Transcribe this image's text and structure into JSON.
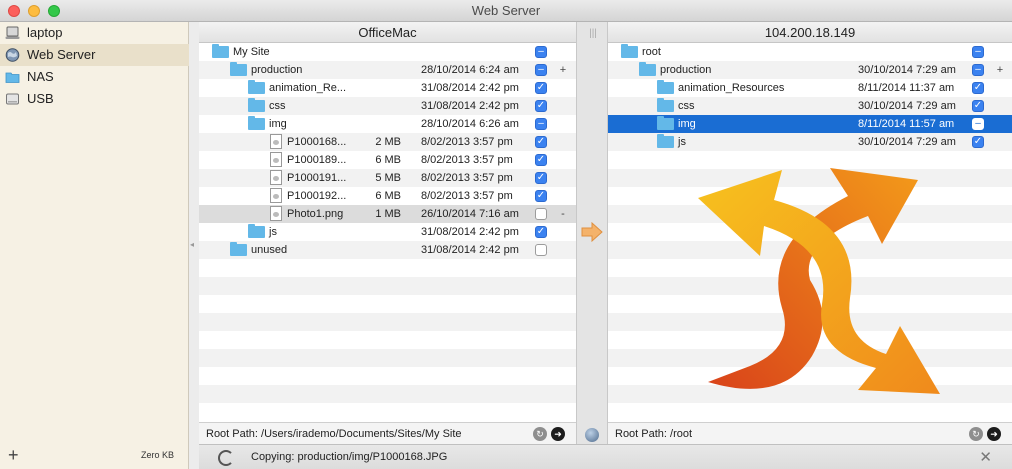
{
  "window": {
    "title": "Web Server"
  },
  "sidebar": {
    "items": [
      {
        "label": "laptop",
        "icon": "laptop-icon"
      },
      {
        "label": "Web Server",
        "icon": "globe-icon"
      },
      {
        "label": "NAS",
        "icon": "folder-icon"
      },
      {
        "label": "USB",
        "icon": "drive-icon"
      }
    ],
    "selected": "Web Server",
    "add_label": "+",
    "footer_size": "Zero KB"
  },
  "left": {
    "header": "OfficeMac",
    "root_path": "Root Path: /Users/irademo/Documents/Sites/My Site",
    "rows": [
      {
        "name": "My Site",
        "size": "",
        "date": "",
        "check": "minus",
        "mark": "",
        "kind": "folder",
        "level": 0,
        "arrow": ""
      },
      {
        "name": "production",
        "size": "",
        "date": "28/10/2014 6:24 am",
        "check": "minus",
        "mark": "+",
        "kind": "folder",
        "level": 1,
        "arrow": "down"
      },
      {
        "name": "animation_Re...",
        "size": "",
        "date": "31/08/2014 2:42 pm",
        "check": "checked",
        "mark": "",
        "kind": "folder",
        "level": 2,
        "arrow": "right"
      },
      {
        "name": "css",
        "size": "",
        "date": "31/08/2014 2:42 pm",
        "check": "checked",
        "mark": "",
        "kind": "folder",
        "level": 2,
        "arrow": "right"
      },
      {
        "name": "img",
        "size": "",
        "date": "28/10/2014 6:26 am",
        "check": "minus",
        "mark": "",
        "kind": "folder",
        "level": 2,
        "arrow": "down"
      },
      {
        "name": "P1000168...",
        "size": "2 MB",
        "date": "8/02/2013 3:57 pm",
        "check": "checked",
        "mark": "",
        "kind": "file",
        "level": 3,
        "arrow": ""
      },
      {
        "name": "P1000189...",
        "size": "6 MB",
        "date": "8/02/2013 3:57 pm",
        "check": "checked",
        "mark": "",
        "kind": "file",
        "level": 3,
        "arrow": ""
      },
      {
        "name": "P1000191...",
        "size": "5 MB",
        "date": "8/02/2013 3:57 pm",
        "check": "checked",
        "mark": "",
        "kind": "file",
        "level": 3,
        "arrow": ""
      },
      {
        "name": "P1000192...",
        "size": "6 MB",
        "date": "8/02/2013 3:57 pm",
        "check": "checked",
        "mark": "",
        "kind": "file",
        "level": 3,
        "arrow": ""
      },
      {
        "name": "Photo1.png",
        "size": "1 MB",
        "date": "26/10/2014 7:16 am",
        "check": "empty",
        "mark": "-",
        "kind": "file",
        "level": 3,
        "arrow": "",
        "highlight": true
      },
      {
        "name": "js",
        "size": "",
        "date": "31/08/2014 2:42 pm",
        "check": "checked",
        "mark": "",
        "kind": "folder",
        "level": 2,
        "arrow": "right"
      },
      {
        "name": "unused",
        "size": "",
        "date": "31/08/2014 2:42 pm",
        "check": "empty",
        "mark": "",
        "kind": "folder",
        "level": 1,
        "arrow": "right"
      }
    ]
  },
  "right": {
    "header": "104.200.18.149",
    "root_path": "Root Path: /root",
    "rows": [
      {
        "name": "root",
        "date": "",
        "check": "minus",
        "mark": "",
        "kind": "folder",
        "level": 0,
        "arrow": ""
      },
      {
        "name": "production",
        "date": "30/10/2014 7:29 am",
        "check": "minus",
        "mark": "+",
        "kind": "folder",
        "level": 1,
        "arrow": "down"
      },
      {
        "name": "animation_Resources",
        "date": "8/11/2014 11:37 am",
        "check": "checked",
        "mark": "",
        "kind": "folder",
        "level": 2,
        "arrow": "right"
      },
      {
        "name": "css",
        "date": "30/10/2014 7:29 am",
        "check": "checked",
        "mark": "",
        "kind": "folder",
        "level": 2,
        "arrow": "right"
      },
      {
        "name": "img",
        "date": "8/11/2014 11:57 am",
        "check": "minus",
        "mark": "",
        "kind": "folder",
        "level": 2,
        "arrow": "right",
        "selected": true
      },
      {
        "name": "js",
        "date": "30/10/2014 7:29 am",
        "check": "checked",
        "mark": "",
        "kind": "folder",
        "level": 2,
        "arrow": "right"
      }
    ]
  },
  "status": {
    "text": "Copying: production/img/P1000168.JPG",
    "close": "✕"
  },
  "glyphs": {
    "arrow_down": "▼",
    "arrow_right": "▶",
    "check": "✓",
    "minus": "–",
    "refresh": "↻",
    "go": "➜",
    "grip": "|||",
    "sidebar_grip": "◂"
  },
  "colors": {
    "selection": "#1a6dd3",
    "checkbox": "#3b82f0",
    "folder": "#63b8e8",
    "sidebar_bg": "#f6f1e4",
    "sidebar_selected": "#e9e0ca",
    "sync_arrow_orange": "#f08a1c",
    "sync_arrow_yellow": "#f7c21e"
  }
}
